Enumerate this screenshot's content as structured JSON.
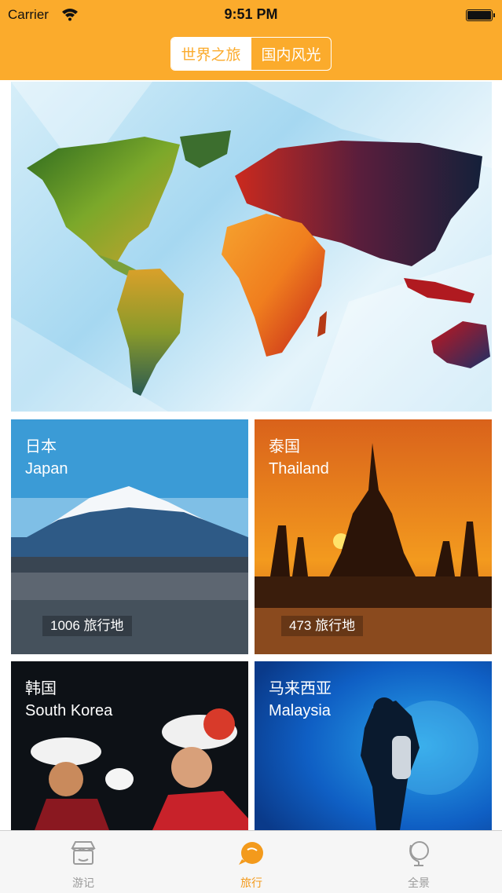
{
  "status_bar": {
    "carrier": "Carrier",
    "time": "9:51 PM"
  },
  "segment": {
    "items": [
      "世界之旅",
      "国内风光"
    ],
    "selected": 0
  },
  "colors": {
    "accent": "#fbab2c",
    "tab_active": "#f39a1c",
    "tab_inactive": "#9b9b9b"
  },
  "destinations": [
    {
      "zh": "日本",
      "en": "Japan",
      "count": "1006 旅行地"
    },
    {
      "zh": "泰国",
      "en": "Thailand",
      "count": "473 旅行地"
    },
    {
      "zh": "韩国",
      "en": "South Korea"
    },
    {
      "zh": "马来西亚",
      "en": "Malaysia"
    }
  ],
  "tabbar": {
    "items": [
      {
        "label": "游记",
        "icon": "shop-icon"
      },
      {
        "label": "旅行",
        "icon": "bubble-icon"
      },
      {
        "label": "全景",
        "icon": "globe-icon"
      }
    ],
    "selected": 1
  }
}
